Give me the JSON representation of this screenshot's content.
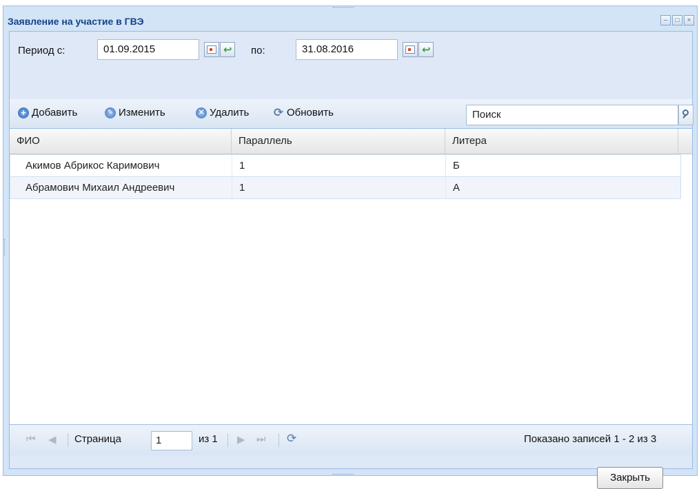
{
  "window": {
    "title": "Заявление на участие в ГВЭ"
  },
  "period": {
    "from_label": "Период с:",
    "from_value": "01.09.2015",
    "to_label": "по:",
    "to_value": "31.08.2016"
  },
  "toolbar": {
    "add_label": "Добавить",
    "edit_label": "Изменить",
    "delete_label": "Удалить",
    "refresh_label": "Обновить",
    "search_placeholder": "Поиск"
  },
  "grid": {
    "columns": [
      "ФИО",
      "Параллель",
      "Литера"
    ],
    "rows": [
      {
        "fio": "Акимов Абрикос Каримович",
        "parallel": "1",
        "litera": "Б"
      },
      {
        "fio": "Абрамович Михаил Андреевич",
        "parallel": "1",
        "litera": "А"
      }
    ]
  },
  "pager": {
    "page_label": "Страница",
    "page_value": "1",
    "of_label": "из 1",
    "summary": "Показано записей 1 - 2 из 3"
  },
  "footer": {
    "close_label": "Закрыть"
  },
  "colors": {
    "title": "#15428b",
    "panel": "#dfe8f6",
    "border": "#99bbe8"
  }
}
